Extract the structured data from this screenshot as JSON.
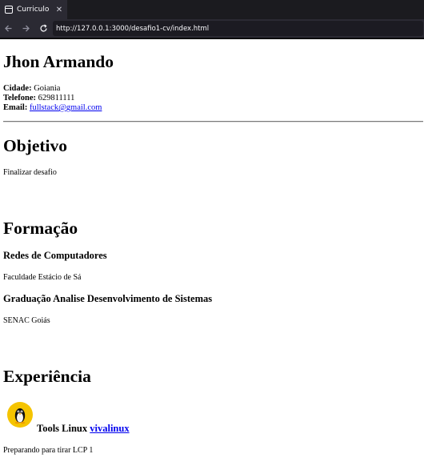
{
  "browser": {
    "tab_title": "Curriculo",
    "tab_close": "✕",
    "url": "http://127.0.0.1:3000/desafio1-cv/index.html"
  },
  "resume": {
    "name": "Jhon Armando",
    "contact": {
      "city_label": "Cidade:",
      "city": "Goiania",
      "phone_label": "Telefone:",
      "phone": "629811111",
      "email_label": "Email:",
      "email": "fullstack@gmail.com"
    },
    "objetivo": {
      "title": "Objetivo",
      "text": "Finalizar desafio"
    },
    "formacao": {
      "title": "Formação",
      "items": [
        {
          "course": "Redes de Computadores",
          "school": "Faculdade Estácio de Sá"
        },
        {
          "course": "Graduação Analise Desenvolvimento de Sistemas",
          "school": "SENAC Goiás"
        }
      ]
    },
    "experiencia": {
      "title": "Experiência",
      "items": [
        {
          "icon": "tux-icon",
          "title": "Tools Linux",
          "link": "vivalinux",
          "desc": "Preparando para tirar LCP 1"
        }
      ]
    }
  }
}
